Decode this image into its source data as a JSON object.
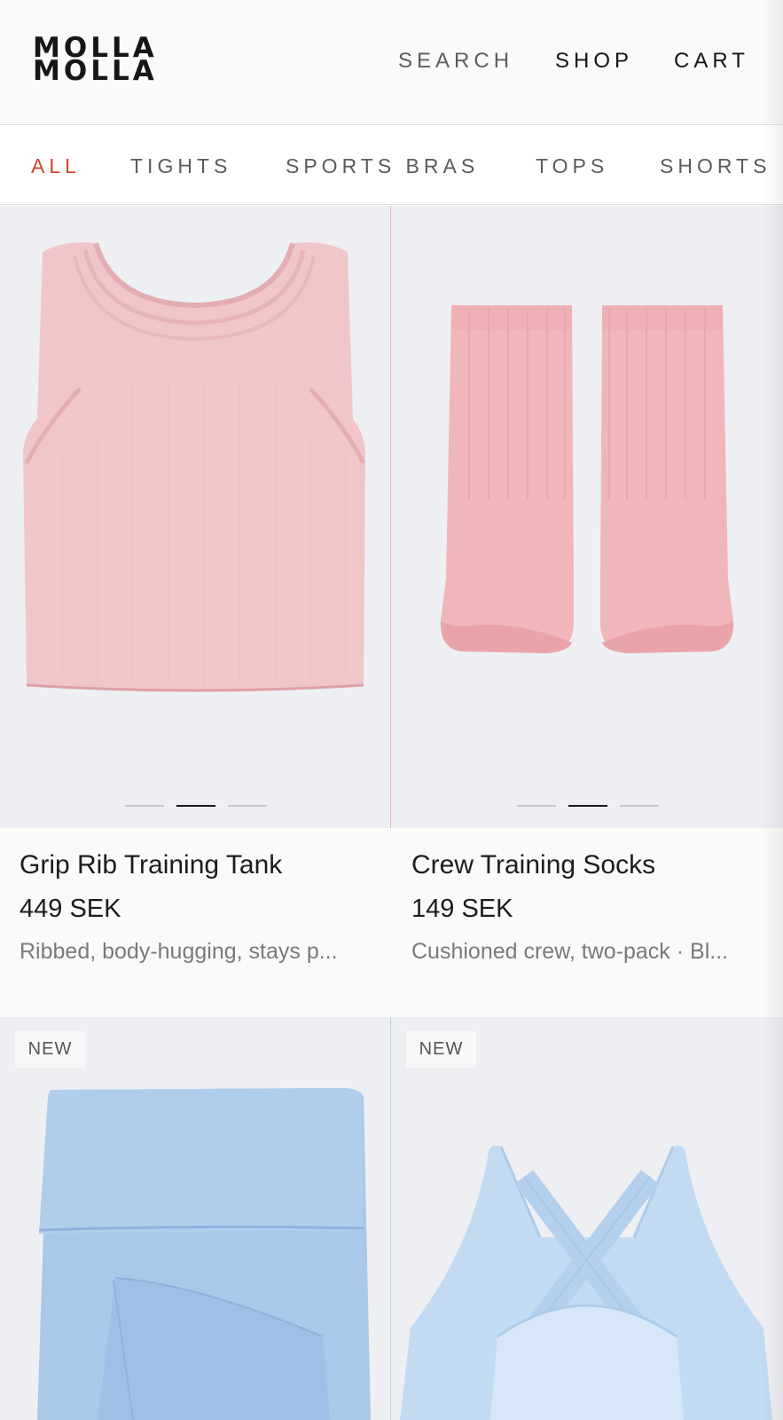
{
  "brand": {
    "line1": "MOLLA",
    "line2": "MOLLA"
  },
  "nav": {
    "search": "SEARCH",
    "shop": "SHOP",
    "cart": "CART"
  },
  "categories": {
    "active_color": "#d0452c",
    "items": [
      {
        "label": "ALL",
        "active": true
      },
      {
        "label": "TIGHTS",
        "active": false
      },
      {
        "label": "SPORTS BRAS",
        "active": false
      },
      {
        "label": "TOPS",
        "active": false
      },
      {
        "label": "SHORTS",
        "active": false
      }
    ]
  },
  "products": [
    {
      "name": "Grip Rib Training Tank",
      "price": "449 SEK",
      "description": "Ribbed, body-hugging, stays p...",
      "color": "#f1c6c8",
      "image_count": 3,
      "image_index": 2
    },
    {
      "name": "Crew Training Socks",
      "price": "149 SEK",
      "description": "Cushioned crew, two-pack · Bl...",
      "color": "#f0b7bb",
      "image_count": 3,
      "image_index": 2
    },
    {
      "badge": "NEW",
      "color": "#a9c8ea"
    },
    {
      "badge": "NEW",
      "color": "#c3dbf2"
    }
  ]
}
